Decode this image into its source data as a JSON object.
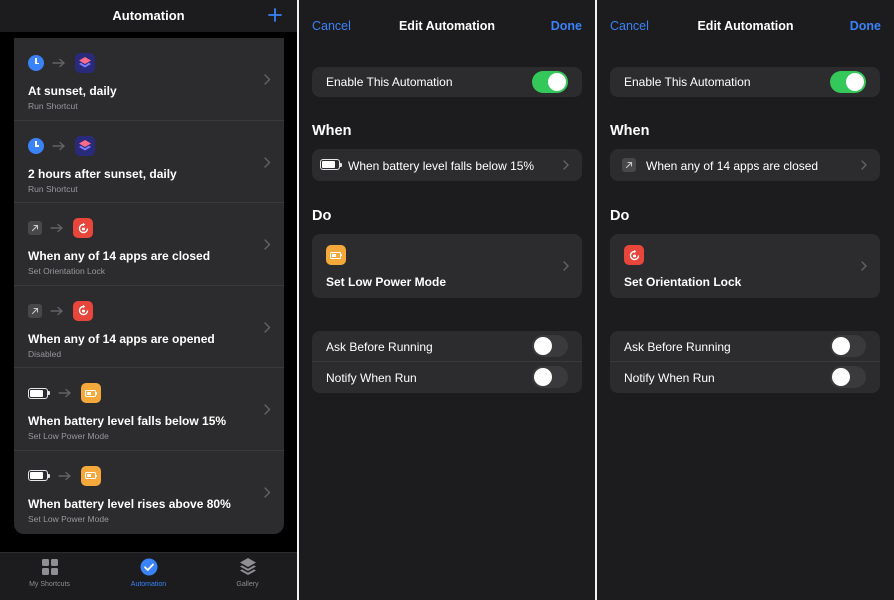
{
  "automation_list": {
    "title": "Automation",
    "rows": [
      {
        "title": "At sunset, daily",
        "subtitle": "Run Shortcut",
        "trigger_icon": "clock-icon",
        "action_icon": "shortcuts-icon"
      },
      {
        "title": "2 hours after sunset, daily",
        "subtitle": "Run Shortcut",
        "trigger_icon": "clock-icon",
        "action_icon": "shortcuts-icon"
      },
      {
        "title": "When any of 14 apps are closed",
        "subtitle": "Set Orientation Lock",
        "trigger_icon": "app-arrow-icon",
        "action_icon": "orientation-lock-icon"
      },
      {
        "title": "When any of 14 apps are opened",
        "subtitle": "Disabled",
        "trigger_icon": "app-arrow-icon",
        "action_icon": "orientation-lock-icon"
      },
      {
        "title": "When battery level falls below 15%",
        "subtitle": "Set Low Power Mode",
        "trigger_icon": "battery-icon",
        "action_icon": "low-power-mode-icon"
      },
      {
        "title": "When battery level rises above 80%",
        "subtitle": "Set Low Power Mode",
        "trigger_icon": "battery-icon",
        "action_icon": "low-power-mode-icon"
      }
    ],
    "tabs": [
      {
        "label": "My Shortcuts",
        "icon": "grid-icon",
        "active": false
      },
      {
        "label": "Automation",
        "icon": "automation-check-icon",
        "active": true
      },
      {
        "label": "Gallery",
        "icon": "layers-icon",
        "active": false
      }
    ]
  },
  "edit_low_power": {
    "cancel": "Cancel",
    "title": "Edit Automation",
    "done": "Done",
    "enable_label": "Enable This Automation",
    "enable_on": true,
    "when_heading": "When",
    "when_text": "When battery level falls below 15%",
    "do_heading": "Do",
    "do_text": "Set Low Power Mode",
    "ask_label": "Ask Before Running",
    "ask_on": false,
    "notify_label": "Notify When Run",
    "notify_on": false
  },
  "edit_orientation": {
    "cancel": "Cancel",
    "title": "Edit Automation",
    "done": "Done",
    "enable_label": "Enable This Automation",
    "enable_on": true,
    "when_heading": "When",
    "when_text": "When any of 14 apps are closed",
    "do_heading": "Do",
    "do_text": "Set Orientation Lock",
    "ask_label": "Ask Before Running",
    "ask_on": false,
    "notify_label": "Notify When Run",
    "notify_on": false
  },
  "colors": {
    "accent": "#3a82f7",
    "toggle_on": "#34c759",
    "orientation_lock": "#e8463b",
    "low_power": "#f5a93a",
    "shortcuts": "#2a2a7a"
  }
}
